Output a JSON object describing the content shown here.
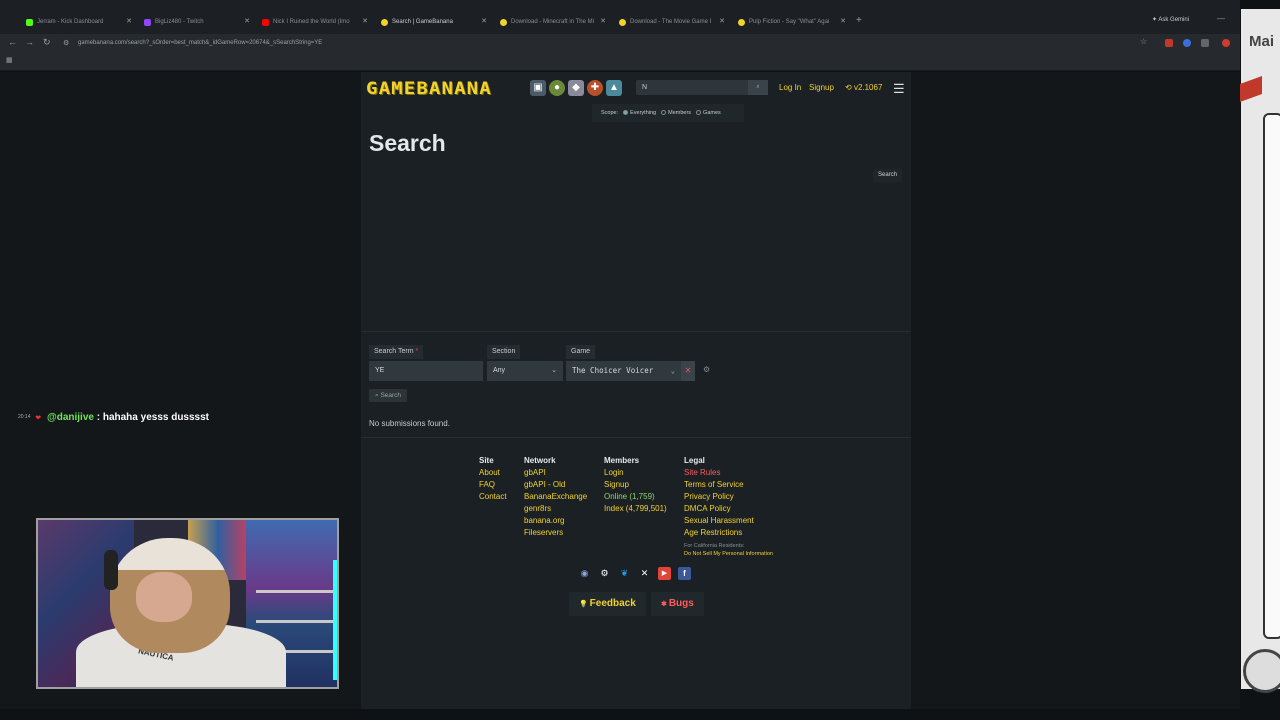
{
  "browser": {
    "tabs": [
      {
        "label": "Jerram - Kick Dashboard",
        "color": "#53fc18"
      },
      {
        "label": "BigLiz480 - Twitch",
        "color": "#9146ff"
      },
      {
        "label": "Nick I Ruined the World (Imo",
        "color": "#ff0000"
      },
      {
        "label": "Search | GameBanana",
        "color": "#f2d22c"
      },
      {
        "label": "Download - Minecraft in The Mi",
        "color": "#f2d22c"
      },
      {
        "label": "Download - The Movie Game I",
        "color": "#f2d22c"
      },
      {
        "label": "Pulp Fiction - Say \"What\" Agai",
        "color": "#f2d22c"
      }
    ],
    "ask_gemini": "Ask Gemini",
    "url": "gamebanana.com/search?_sOrder=best_match&_idGameRow=20674&_sSearchString=YE"
  },
  "edge": {
    "text": "Mai"
  },
  "header": {
    "logo": "GAMEBANANA",
    "search_value": "N",
    "login": "Log In",
    "signup": "Signup",
    "version": "v2.1067"
  },
  "scope": {
    "label": "Scope:",
    "options": [
      "Everything",
      "Members",
      "Games"
    ]
  },
  "main": {
    "title": "Search",
    "search_small": "Search",
    "search_term_label": "Search Term",
    "search_term_value": "YE",
    "section_label": "Section",
    "section_value": "Any",
    "game_label": "Game",
    "game_value": "The Choicer Voicer",
    "search_button": "Search",
    "no_results": "No submissions found."
  },
  "footer": {
    "site": {
      "heading": "Site",
      "links": [
        "About",
        "FAQ",
        "Contact"
      ]
    },
    "network": {
      "heading": "Network",
      "links": [
        "gbAPI",
        "gbAPI - Old",
        "BananaExchange",
        "genr8rs",
        "banana.org",
        "Fileservers"
      ]
    },
    "members": {
      "heading": "Members",
      "links": [
        "Login",
        "Signup"
      ],
      "online": "Online (1,759)",
      "index": "Index (4,799,501)"
    },
    "legal": {
      "heading": "Legal",
      "rules": "Site Rules",
      "links": [
        "Terms of Service",
        "Privacy Policy",
        "DMCA Policy",
        "Sexual Harassment",
        "Age Restrictions"
      ],
      "ca_note": "For California Residents:",
      "ca_link": "Do Not Sell My Personal Information"
    },
    "feedback": "Feedback",
    "bugs": "Bugs"
  },
  "chat": {
    "time": "20:14",
    "user": "@danijive",
    "message": ": hahaha yesss dusssst"
  },
  "webcam": {
    "shirt_text": "NAUTICA"
  },
  "colors": {
    "accent": "#f2d22c",
    "online": "#8fd36b",
    "danger": "#ff5a5a",
    "chat_user": "#6fe35b"
  }
}
